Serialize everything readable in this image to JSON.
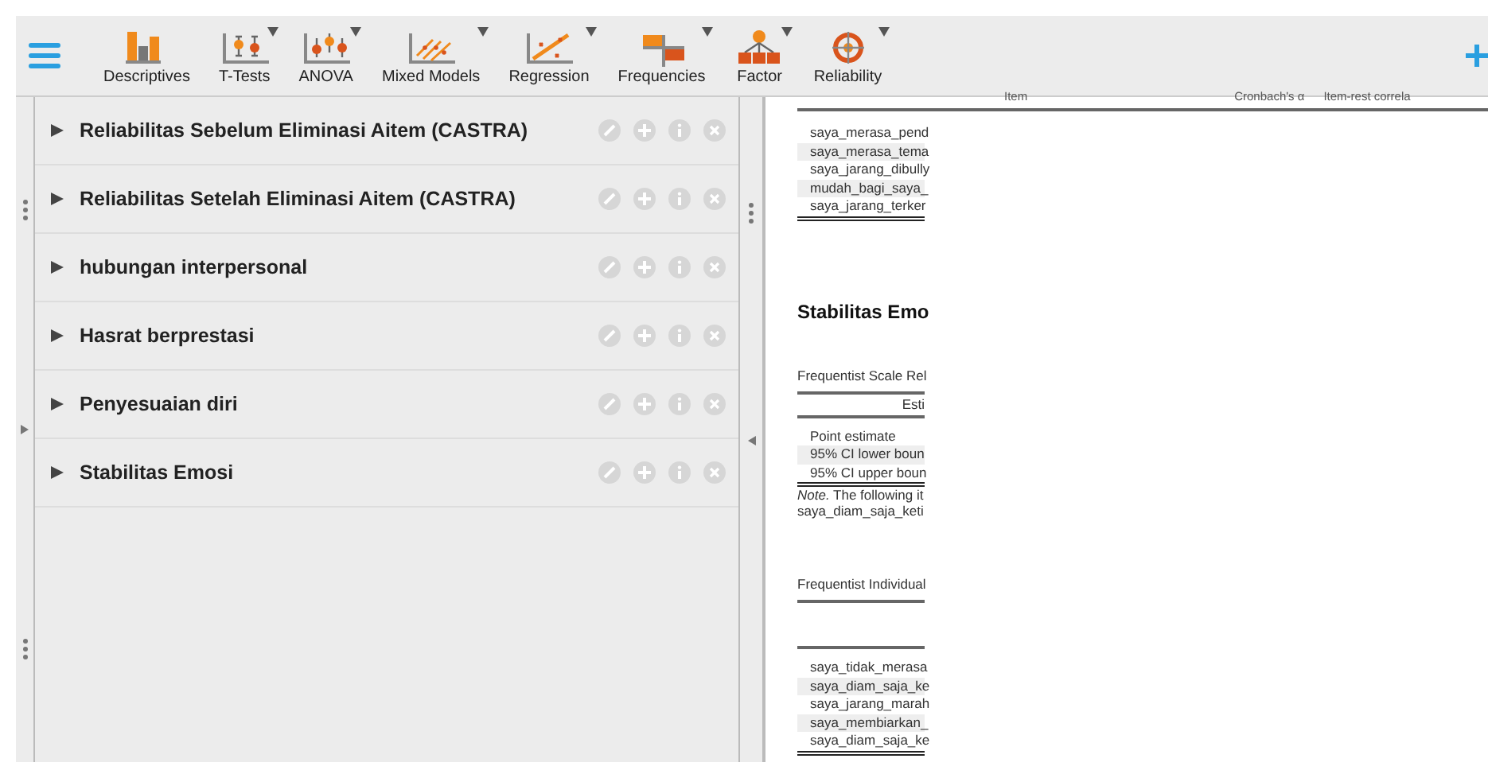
{
  "toolbar": {
    "modules": [
      {
        "label": "Descriptives",
        "kind": "bars",
        "menu": false
      },
      {
        "label": "T-Tests",
        "kind": "ttest",
        "menu": true
      },
      {
        "label": "ANOVA",
        "kind": "anova",
        "menu": true
      },
      {
        "label": "Mixed Models",
        "kind": "mixed",
        "menu": true
      },
      {
        "label": "Regression",
        "kind": "regression",
        "menu": true
      },
      {
        "label": "Frequencies",
        "kind": "frequencies",
        "menu": true
      },
      {
        "label": "Factor",
        "kind": "factor",
        "menu": true
      },
      {
        "label": "Reliability",
        "kind": "reliability",
        "menu": true
      }
    ]
  },
  "analyses": [
    {
      "title": "Reliabilitas Sebelum Eliminasi Aitem (CASTRA)",
      "expanded": false
    },
    {
      "title": "Reliabilitas Setelah Eliminasi Aitem (CASTRA)",
      "expanded": false
    },
    {
      "title": "hubungan interpersonal",
      "expanded": false
    },
    {
      "title": "Hasrat berprestasi",
      "expanded": false
    },
    {
      "title": "Penyesuaian diri",
      "expanded": false
    },
    {
      "title": "Stabilitas Emosi",
      "expanded": false
    }
  ],
  "output": {
    "top_table": {
      "columns": [
        "Item",
        "Cronbach's α",
        "Item-rest correla"
      ],
      "rows": [
        "saya_merasa_pend",
        "saya_merasa_tema",
        "saya_jarang_dibully",
        "mudah_bagi_saya_",
        "saya_jarang_terker"
      ]
    },
    "heading": "Stabilitas Emo",
    "scale_table": {
      "title": "Frequentist Scale Rel",
      "columns": [
        "Esti"
      ],
      "rows": [
        "Point estimate",
        "95% CI lower boun",
        "95% CI upper boun"
      ],
      "note_label": "Note.",
      "note": " The following it",
      "note_line2": "saya_diam_saja_keti"
    },
    "item_table": {
      "title": "Frequentist Individual",
      "rows": [
        "saya_tidak_merasa",
        "saya_diam_saja_ke",
        "saya_jarang_marah",
        "saya_membiarkan_",
        "saya_diam_saja_ke"
      ]
    }
  }
}
